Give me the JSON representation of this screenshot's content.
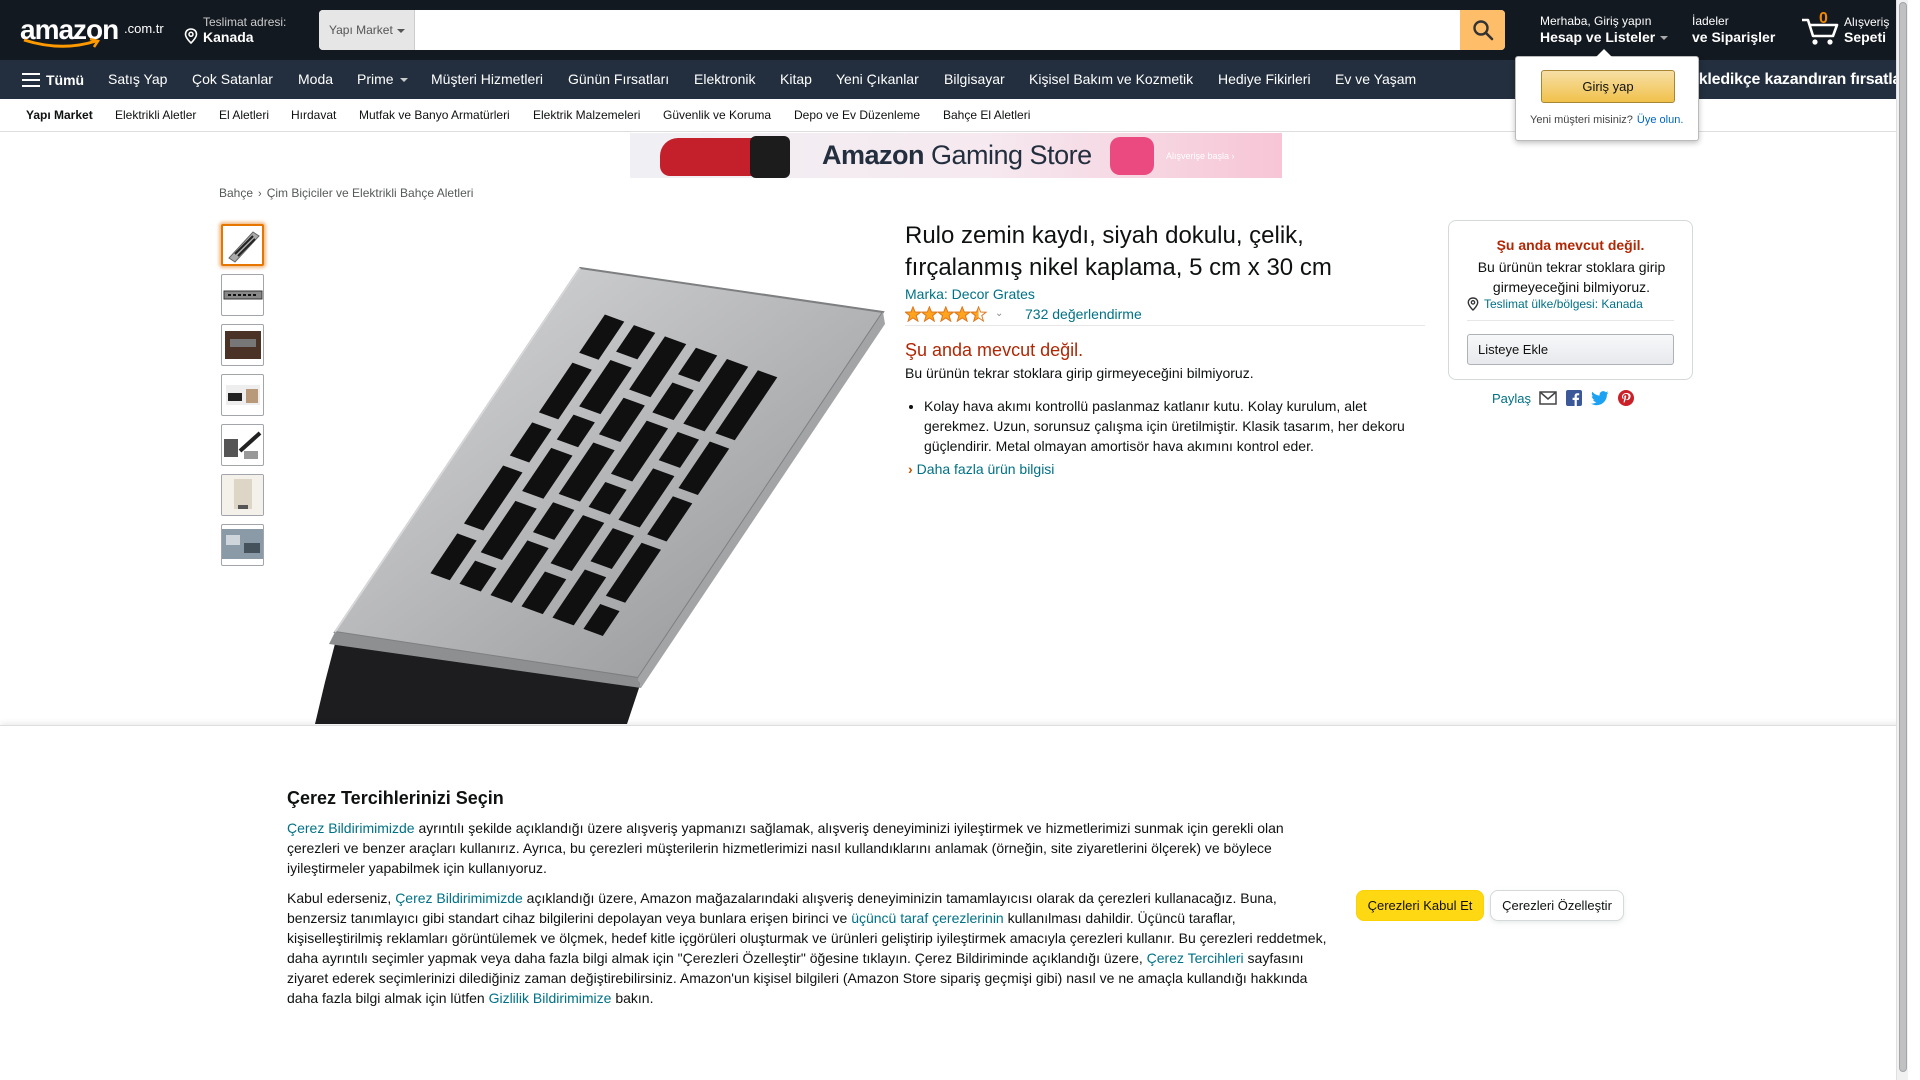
{
  "header": {
    "logo_text": "amazon",
    "logo_tld": ".com.tr",
    "deliver_label": "Teslimat adresi:",
    "deliver_location": "Kanada",
    "search_category": "Yapı Market",
    "search_placeholder": "",
    "account_greeting": "Merhaba, Giriş yapın",
    "account_label": "Hesap ve Listeler",
    "orders_line1": "İadeler",
    "orders_line2": "ve Siparişler",
    "cart_count": "0",
    "cart_line1": "Alışveriş",
    "cart_line2": "Sepeti"
  },
  "nav": {
    "all_label": "Tümü",
    "items": [
      "Satış Yap",
      "Çok Satanlar",
      "Moda",
      "Prime",
      "Müşteri Hizmetleri",
      "Günün Fırsatları",
      "Elektronik",
      "Kitap",
      "Yeni Çıkanlar",
      "Bilgisayar",
      "Kişisel Bakım ve Kozmetik",
      "Hediye Fikirleri",
      "Ev ve Yaşam"
    ],
    "promo": "ekledikçe kazandıran fırsatlar"
  },
  "subnav": {
    "items": [
      "Yapı Market",
      "Elektrikli Aletler",
      "El Aletleri",
      "Hırdavat",
      "Mutfak ve Banyo Armatürleri",
      "Elektrik Malzemeleri",
      "Güvenlik ve Koruma",
      "Depo ve Ev Düzenleme",
      "Bahçe El Aletleri"
    ]
  },
  "flyout": {
    "signin_label": "Giriş yap",
    "new_customer": "Yeni müşteri misiniz?",
    "register_link": "Üye olun."
  },
  "banner": {
    "title_bold": "Amazon",
    "title_rest": " Gaming Store",
    "cta": "Alışverişe başla ›"
  },
  "breadcrumb": [
    "Bahçe",
    "Çim Biçiciler ve Elektrikli Bahçe Aletleri"
  ],
  "product": {
    "title": "Rulo zemin kaydı, siyah dokulu, çelik, fırçalanmış nikel kaplama, 5 cm x 30 cm",
    "brand": "Marka: Decor Grates",
    "rating_stars": 4.5,
    "rating_count": "732 değerlendirme",
    "availability": "Şu anda mevcut değil.",
    "availability_note": "Bu ürünün tekrar stoklara girip girmeyeceğini bilmiyoruz.",
    "bullets": [
      "Kolay hava akımı kontrollü paslanmaz katlanır kutu. Kolay kurulum, alet gerekmez. Uzun, sorunsuz çalışma için üretilmiştir. Klasik tasarım, her dekoru güçlendirir. Metal olmayan amortisör hava akımını kontrol eder."
    ],
    "more_info": "Daha fazla ürün bilgisi"
  },
  "buybox": {
    "heading": "Şu anda mevcut değil.",
    "text": "Bu ürünün tekrar stoklara girip girmeyeceğini bilmiyoruz.",
    "location": "Teslimat ülke/bölgesi: Kanada",
    "add_to_list": "Listeye Ekle"
  },
  "share": {
    "label": "Paylaş",
    "icons": [
      "email-icon",
      "facebook-icon",
      "twitter-icon",
      "pinterest-icon"
    ]
  },
  "cookie": {
    "title": "Çerez Tercihlerinizi Seçin",
    "p1_link": "Çerez Bildirimimizde",
    "p1_text": " ayrıntılı şekilde açıklandığı üzere alışveriş yapmanızı sağlamak, alışveriş deneyiminizi iyileştirmek ve hizmetlerimizi sunmak için gerekli olan çerezleri ve benzer araçları kullanırız. Ayrıca, bu çerezleri müşterilerin hizmetlerimizi nasıl kullandıklarını anlamak (örneğin, site ziyaretlerini ölçerek) ve böylece iyileştirmeler yapabilmek için kullanıyoruz.",
    "p2_a": "Kabul ederseniz, ",
    "p2_link1": "Çerez Bildirimimizde",
    "p2_b": " açıklandığı üzere, Amazon mağazalarındaki alışveriş deneyiminizin tamamlayıcısı olarak da çerezleri kullanacağız. Buna, benzersiz tanımlayıcı gibi standart cihaz bilgilerini depolayan veya bunlara erişen birinci ve ",
    "p2_link2": "üçüncü taraf çerezlerinin",
    "p2_c": " kullanılması dahildir. Üçüncü taraflar, kişiselleştirilmiş reklamları görüntülemek ve ölçmek, hedef kitle içgörüleri oluşturmak ve ürünleri geliştirip iyileştirmek amacıyla çerezleri kullanır. Bu çerezleri reddetmek, daha ayrıntılı seçimler yapmak veya daha fazla bilgi almak için \"Çerezleri Özelleştir\" öğesine tıklayın. Çerez Bildiriminde açıklandığı üzere, ",
    "p2_link3": "Çerez Tercihleri",
    "p2_d": " sayfasını ziyaret ederek seçimlerinizi dilediğiniz zaman değiştirebilirsiniz. Amazon'un kişisel bilgileri (Amazon Store sipariş geçmişi gibi) nasıl ve ne amaçla kullandığı hakkında daha fazla bilgi almak için lütfen ",
    "p2_link4": "Gizlilik Bildirimimize",
    "p2_e": " bakın.",
    "accept_label": "Çerezleri Kabul Et",
    "customize_label": "Çerezleri Özelleştir"
  },
  "colors": {
    "nav_dark": "#131921",
    "nav_secondary": "#232f3e",
    "search_button": "#febd69",
    "link": "#007185",
    "unavailable": "#b12704",
    "accept_button": "#ffd814"
  }
}
